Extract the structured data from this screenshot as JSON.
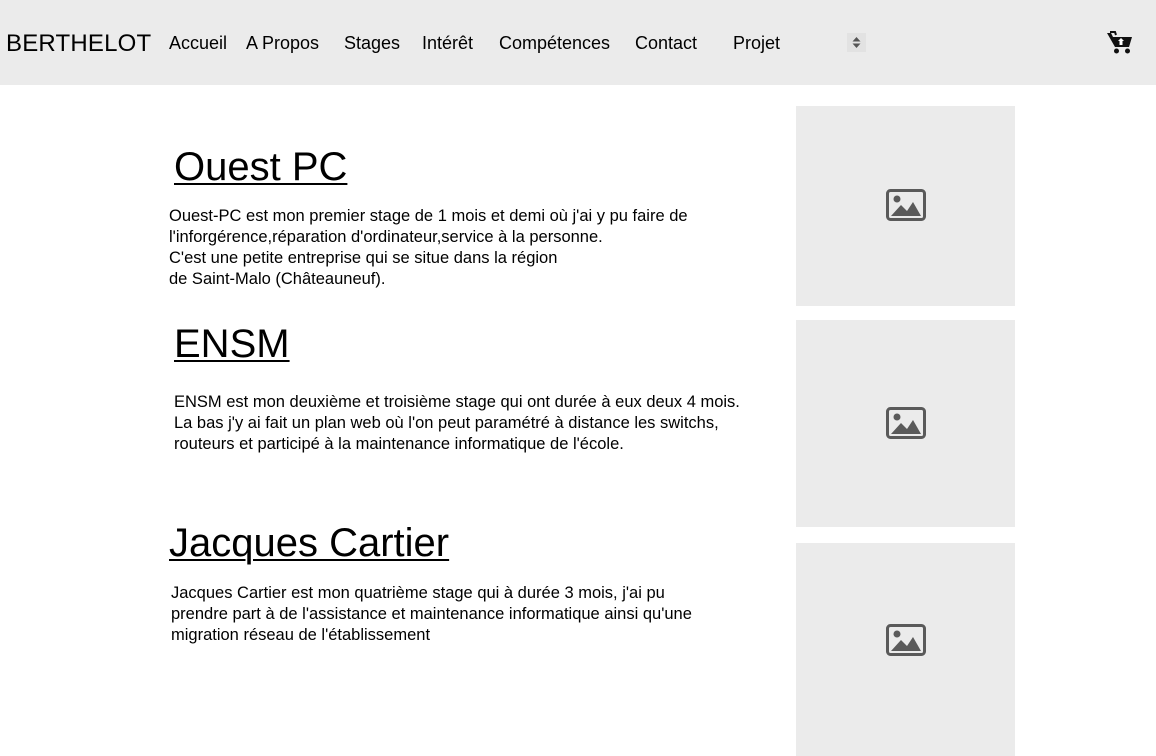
{
  "header": {
    "brand": "BERTHELOT",
    "nav": [
      {
        "label": "Accueil"
      },
      {
        "label": "A Propos"
      },
      {
        "label": "Stages"
      },
      {
        "label": "Intérêt"
      },
      {
        "label": "Compétences"
      },
      {
        "label": "Contact"
      },
      {
        "label": "Projet"
      }
    ],
    "more_icon": "sort-arrows-icon",
    "cart_icon": "cart-icon"
  },
  "sections": [
    {
      "title": "Ouest PC",
      "lines": [
        "Ouest-PC est mon premier stage de 1 mois et demi où j'ai y pu faire de",
        "l'inforgérence,réparation d'ordinateur,service à la personne.",
        "C'est une petite entreprise qui se situe dans la région",
        "de Saint-Malo (Châteauneuf)."
      ],
      "image_icon": "image-placeholder-icon"
    },
    {
      "title": "ENSM",
      "lines": [
        "ENSM est mon deuxième et troisième stage qui ont durée à eux deux 4 mois.",
        "La bas j'y ai fait un plan web où l'on peut paramétré à distance les switchs,",
        "routeurs et participé à la maintenance informatique de l'école."
      ],
      "image_icon": "image-placeholder-icon"
    },
    {
      "title": "Jacques Cartier",
      "lines": [
        "Jacques Cartier est mon quatrième stage qui à durée 3 mois, j'ai pu",
        "prendre part à de l'assistance et maintenance informatique ainsi qu'une",
        "migration réseau de l'établissement"
      ],
      "image_icon": "image-placeholder-icon"
    }
  ],
  "colors": {
    "header_bg": "#ebebeb",
    "image_bg": "#ebebeb",
    "icon": "#5a5a5a",
    "text": "#000000"
  }
}
